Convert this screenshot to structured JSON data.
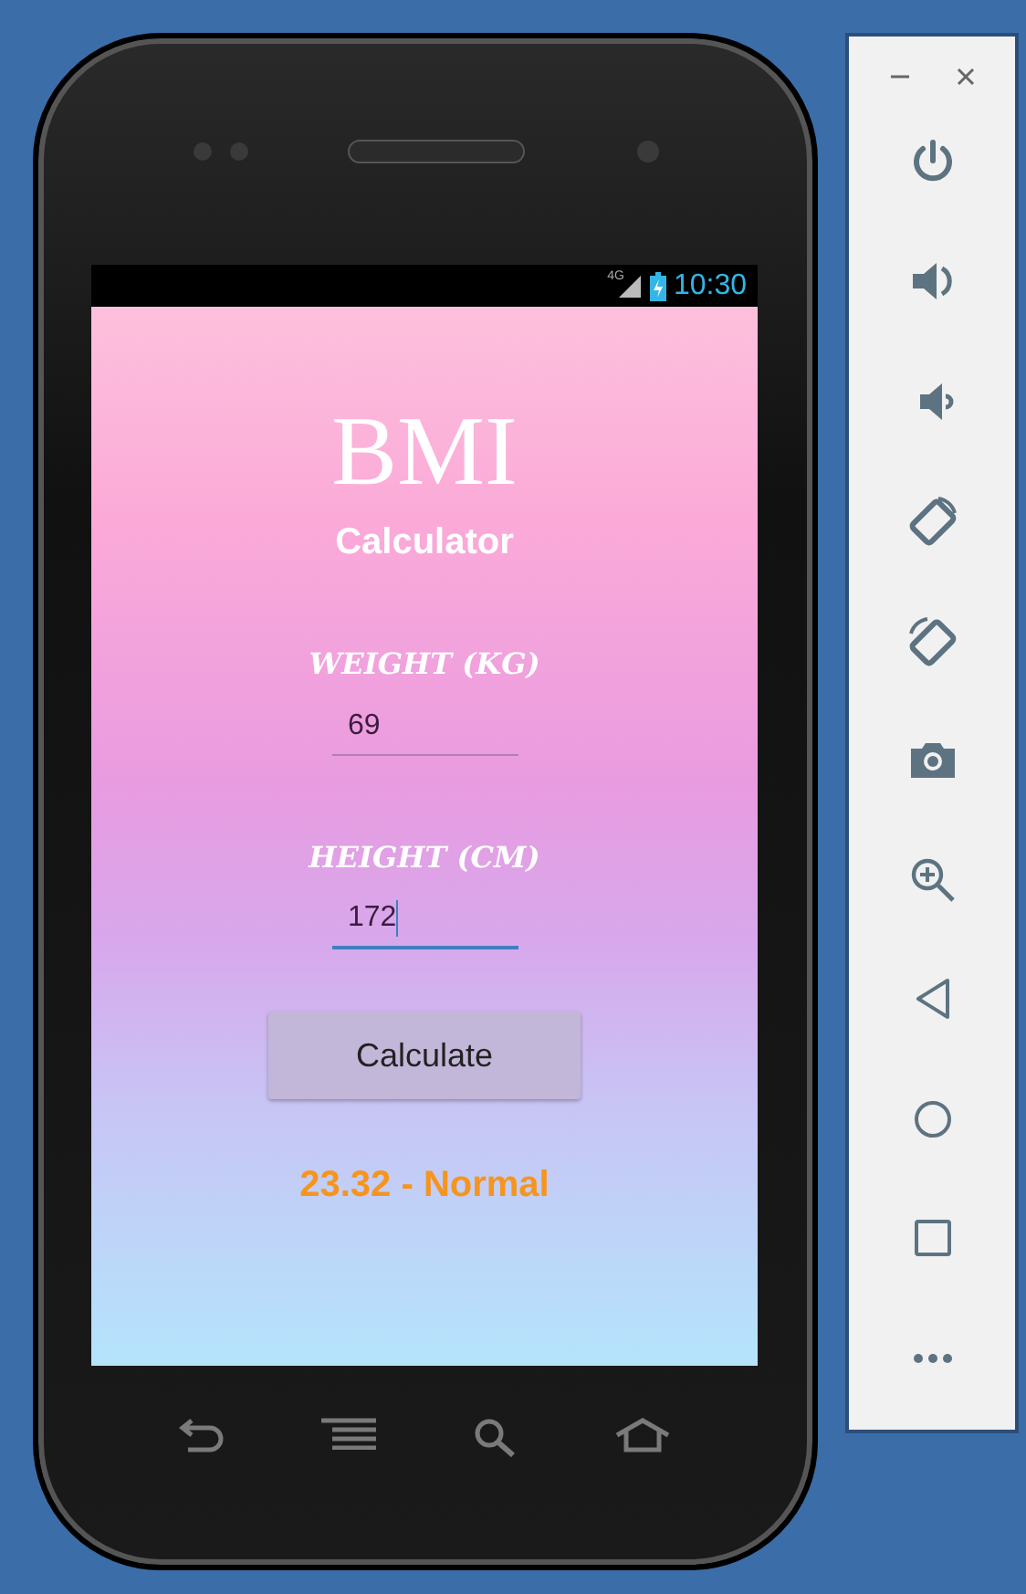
{
  "status_bar": {
    "network": "4G",
    "time": "10:30"
  },
  "app": {
    "title": "BMI",
    "subtitle": "Calculator",
    "fields": [
      {
        "label": "WEIGHT (KG)",
        "value": "69",
        "focused": false
      },
      {
        "label": "HEIGHT (CM)",
        "value": "172",
        "focused": true
      }
    ],
    "button": "Calculate",
    "result": "23.32 - Normal"
  }
}
